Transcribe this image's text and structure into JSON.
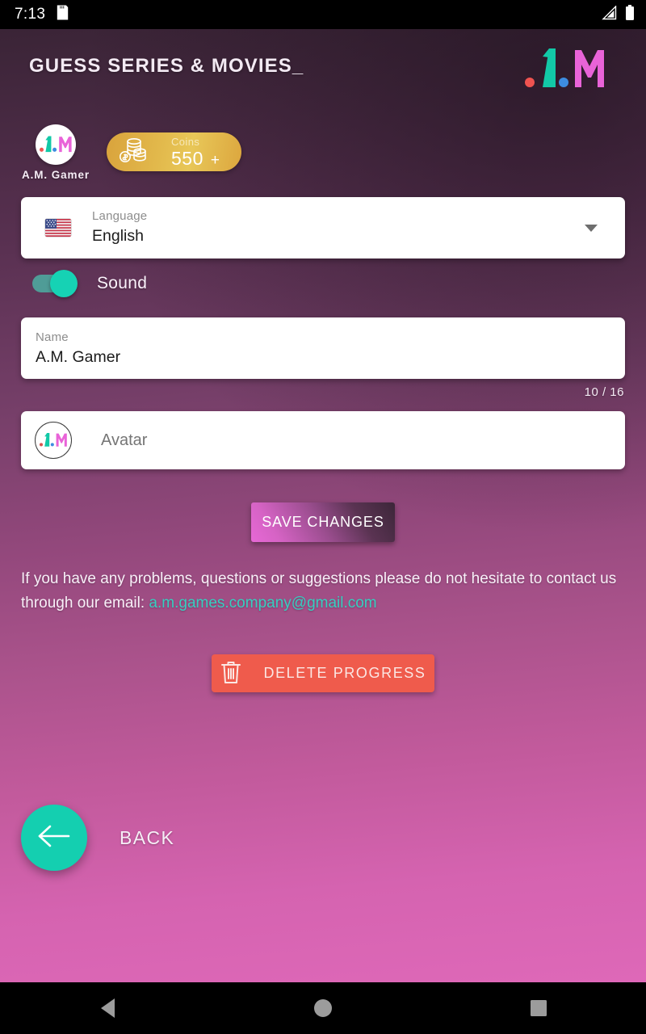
{
  "status_bar": {
    "time": "7:13",
    "sd_card_icon": "sd-card-icon",
    "signal_icon": "signal-bars-icon",
    "battery_icon": "battery-full-icon"
  },
  "header": {
    "app_title": "GUESS SERIES & MOVIES_",
    "brand_logo_icon": "am-brand-logo-icon",
    "brand_colors": {
      "red_dot": "#ef5350",
      "teal_a": "#12c9a7",
      "blue_dot": "#3d8ce0",
      "pink_m": "#e963d8"
    }
  },
  "profile": {
    "avatar_icon": "am-avatar-icon",
    "player_name": "A.M. Gamer",
    "coins": {
      "icon": "coin-stack-icon",
      "label": "Coins",
      "value": "550",
      "plus": "+"
    }
  },
  "language_field": {
    "flag_icon": "us-flag-icon",
    "label": "Language",
    "value": "English",
    "chevron_icon": "chevron-down-icon"
  },
  "sound_setting": {
    "label": "Sound",
    "enabled": true
  },
  "name_field": {
    "label": "Name",
    "value": "A.M. Gamer",
    "counter": "10 / 16"
  },
  "avatar_field": {
    "avatar_icon": "am-avatar-icon",
    "placeholder": "Avatar"
  },
  "save_button": {
    "label": "SAVE CHANGES"
  },
  "contact": {
    "text_before": "If you have any problems, questions or suggestions please do not hesitate to contact us through our email: ",
    "email": "a.m.games.company@gmail.com",
    "email_color": "#36cfc0"
  },
  "delete_button": {
    "icon": "trash-can-icon",
    "label": "DELETE PROGRESS",
    "color": "#ef5b4c"
  },
  "back_button": {
    "icon": "arrow-left-icon",
    "label": "BACK",
    "color": "#14cfb0"
  },
  "nav_bar": {
    "back_icon": "nav-back-triangle-icon",
    "home_icon": "nav-home-circle-icon",
    "recents_icon": "nav-recents-square-icon"
  }
}
